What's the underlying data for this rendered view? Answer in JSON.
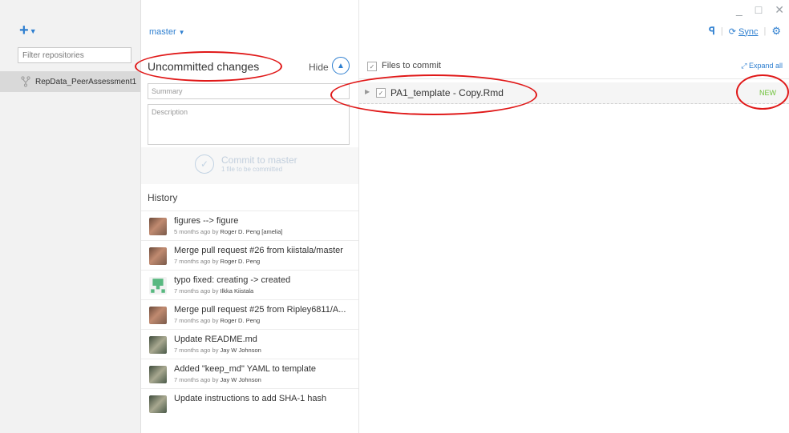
{
  "window_controls": {
    "minimize": "_",
    "maximize": "□",
    "close": "✕"
  },
  "sidebar": {
    "add_label": "+",
    "filter_placeholder": "Filter repositories",
    "repositories": [
      {
        "name": "RepData_PeerAssessment1"
      }
    ]
  },
  "branch": {
    "name": "master"
  },
  "toolbar": {
    "sync_label": "Sync"
  },
  "changes": {
    "title": "Uncommitted changes",
    "hide_label": "Hide",
    "summary_placeholder": "Summary",
    "description_placeholder": "Description",
    "commit_button": "Commit to master",
    "commit_subtitle": "1 file to be committed"
  },
  "files": {
    "header": "Files to commit",
    "expand_all": "Expand all",
    "items": [
      {
        "name": "PA1_template - Copy.Rmd",
        "status": "NEW"
      }
    ]
  },
  "history": {
    "title": "History",
    "items": [
      {
        "title": "figures --> figure",
        "time": "5 months ago by",
        "author": "Roger D. Peng [amelia]",
        "avatar": "photo"
      },
      {
        "title": "Merge pull request #26 from kiistala/master",
        "time": "7 months ago by",
        "author": "Roger D. Peng",
        "avatar": "photo"
      },
      {
        "title": "typo fixed: creating -> created",
        "time": "7 months ago by",
        "author": "Ilkka Kiistala",
        "avatar": "identicon"
      },
      {
        "title": "Merge pull request #25 from Ripley6811/A...",
        "time": "7 months ago by",
        "author": "Roger D. Peng",
        "avatar": "photo"
      },
      {
        "title": "Update README.md",
        "time": "7 months ago by",
        "author": "Jay W Johnson",
        "avatar": "photo2"
      },
      {
        "title": "Added \"keep_md\" YAML to template",
        "time": "7 months ago by",
        "author": "Jay W Johnson",
        "avatar": "photo2"
      },
      {
        "title": "Update instructions to add SHA-1 hash",
        "time": "",
        "author": "",
        "avatar": "photo2"
      }
    ]
  },
  "colors": {
    "accent": "#2e7fd0",
    "new_status": "#6fc23a",
    "annotation": "#e01818"
  }
}
